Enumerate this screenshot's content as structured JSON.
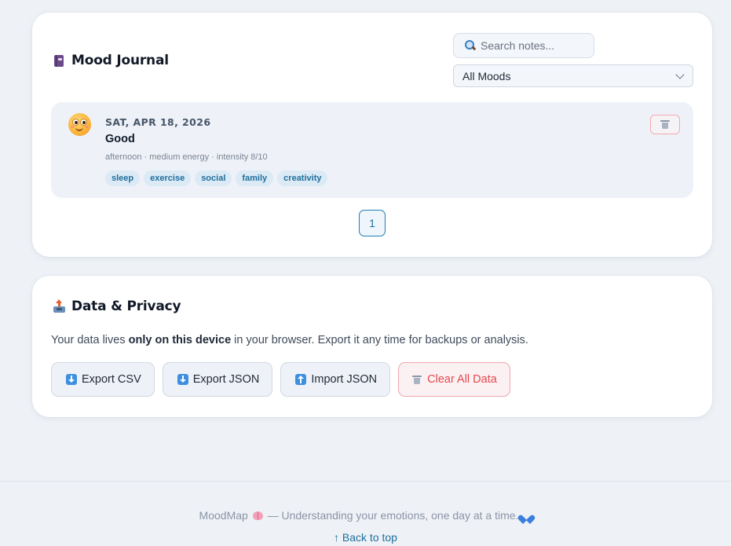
{
  "journal": {
    "title": "Mood Journal",
    "search_placeholder": "Search notes...",
    "mood_filter": "All Moods",
    "entries": [
      {
        "date": "SAT, APR 18, 2026",
        "mood": "Good",
        "meta": "afternoon · medium energy · intensity 8/10",
        "tags": [
          "sleep",
          "exercise",
          "social",
          "family",
          "creativity"
        ],
        "icon": "smiling-face-emoji"
      }
    ],
    "pagination": {
      "current_page": "1"
    }
  },
  "privacy": {
    "title": "Data & Privacy",
    "text_before": "Your data lives ",
    "text_bold": "only on this device",
    "text_after": " in your browser. Export it any time for backups or analysis.",
    "buttons": {
      "export_csv": "Export CSV",
      "export_json": "Export JSON",
      "import_json": "Import JSON",
      "clear_all": "Clear All Data"
    }
  },
  "footer": {
    "brand": "MoodMap",
    "tagline": "— Understanding your emotions, one day at a time.",
    "back_to_top": "↑ Back to top"
  },
  "colors": {
    "accent": "#1f7db4",
    "danger": "#e5484d",
    "tag_bg": "#dbeaf5",
    "page_bg": "#eef2f7"
  }
}
